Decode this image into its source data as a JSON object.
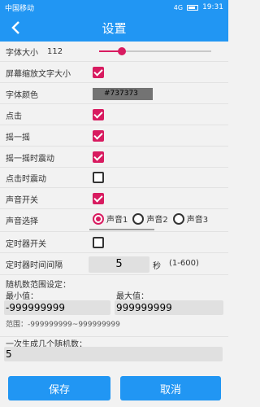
{
  "status": {
    "carrier": "中国移动",
    "time": "19:31",
    "signal_text": "4G"
  },
  "appbar": {
    "title": "设置"
  },
  "font_size": {
    "label": "字体大小",
    "value": "112",
    "slider_fraction": 0.2
  },
  "rows": {
    "screen_zoom": {
      "label": "屏幕缩放文字大小",
      "checked": true
    },
    "font_color": {
      "label": "字体颜色",
      "value": "#737373"
    },
    "click": {
      "label": "点击",
      "checked": true
    },
    "shake": {
      "label": "摇一摇",
      "checked": true
    },
    "shake_vibrate": {
      "label": "摇一摇时震动",
      "checked": true
    },
    "click_vibrate": {
      "label": "点击时震动",
      "checked": false
    },
    "sound_switch": {
      "label": "声音开关",
      "checked": true
    },
    "sound_select": {
      "label": "声音选择",
      "options": [
        "声音1",
        "声音2",
        "声音3"
      ],
      "selected": "声音1"
    },
    "timer_switch": {
      "label": "定时器开关",
      "checked": false
    },
    "timer_interval": {
      "label": "定时器时间间隔",
      "value": "5",
      "unit": "秒",
      "range": "(1-600)"
    }
  },
  "random_range": {
    "title": "随机数范围设定：",
    "min_label": "最小值：",
    "min_value": "-999999999",
    "max_label": "最大值：",
    "max_value": "999999999",
    "hint": "范围：-999999999~999999999"
  },
  "generate": {
    "label": "一次生成几个随机数：",
    "value": "5"
  },
  "buttons": {
    "save": "保存",
    "cancel": "取消"
  },
  "colors": {
    "primary": "#2196f3",
    "accent": "#d81b60"
  },
  "icons": [
    "back-arrow-icon"
  ]
}
